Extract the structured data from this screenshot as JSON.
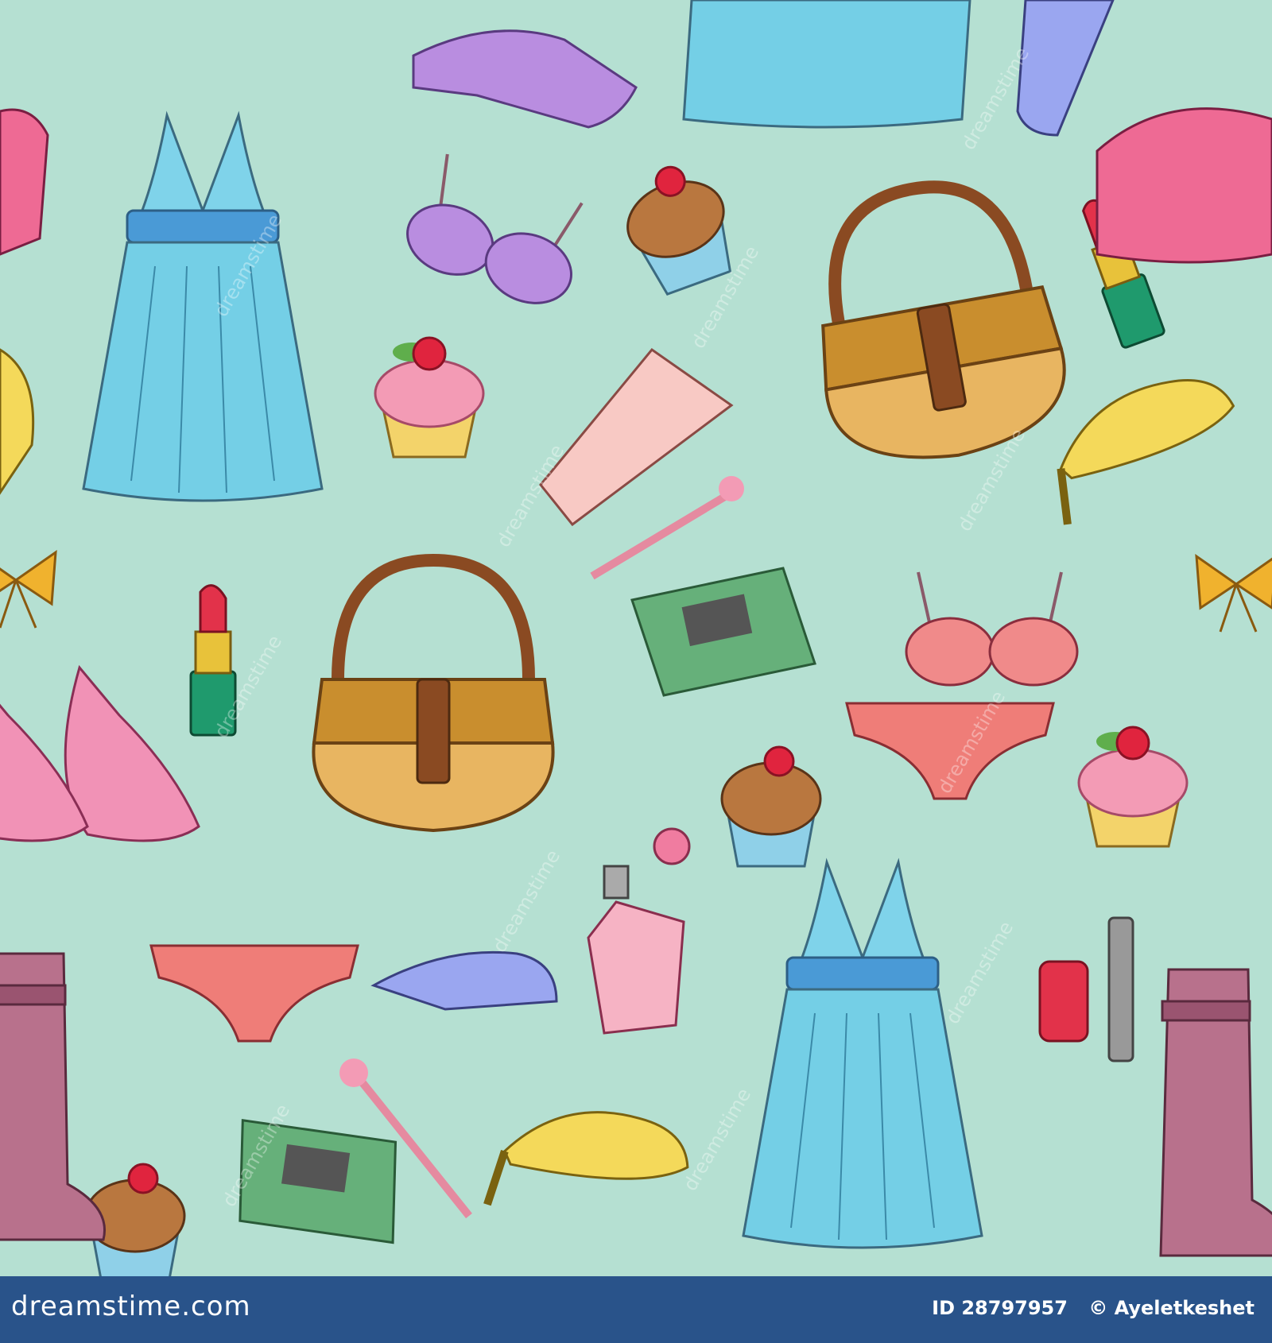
{
  "footer": {
    "brand": "dreamstime.com",
    "id_label": "ID 28797957",
    "author": "© Ayeletkeshet"
  },
  "watermark": {
    "text": "dreamstime"
  },
  "colors": {
    "background": "#b5e0d2",
    "footer": "#29538a",
    "dress": "#6ccbe5",
    "bag": "#d99b3c",
    "pink": "#ef8fa9",
    "yellow": "#f0d65a",
    "purple": "#b98de0",
    "boot": "#b26d86"
  },
  "icons": [
    "dress-icon",
    "handbag-icon",
    "lipstick-icon",
    "cupcake-icon",
    "bra-icon",
    "panties-icon",
    "high-heel-icon",
    "boot-icon",
    "sandal-icon",
    "perfume-icon",
    "nail-polish-icon",
    "notebook-icon",
    "pen-icon",
    "bow-icon",
    "clutch-icon",
    "cream-tube-icon"
  ]
}
